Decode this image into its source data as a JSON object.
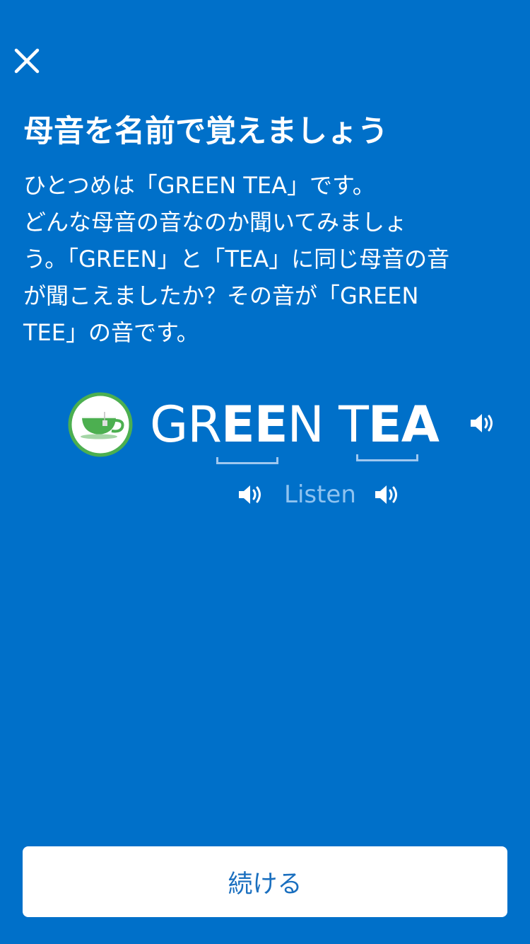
{
  "header": {
    "close_icon": "close-icon",
    "title": "母音を名前で覚えましょう"
  },
  "instructions": {
    "lines": [
      "ひとつめは「GREEN TEA」です。",
      "どんな母音の音なのか聞いてみましょ",
      "う。「GREEN」と「TEA」に同じ母音の音",
      "が聞こえましたか？その音が「GREEN",
      "TEE」の音です。"
    ]
  },
  "word_card": {
    "icon": "green-tea-cup-icon",
    "word_parts": [
      "GR",
      "EE",
      "N T",
      "EA"
    ],
    "speaker_icon": "speaker-icon",
    "accent_color": "#4caf50"
  },
  "listen": {
    "label": "Listen",
    "icon": "speaker-icon"
  },
  "footer": {
    "continue_label": "続ける"
  },
  "colors": {
    "background": "#0070c9",
    "button_text": "#1a6fbf",
    "listen_text": "#8fc3f0"
  }
}
